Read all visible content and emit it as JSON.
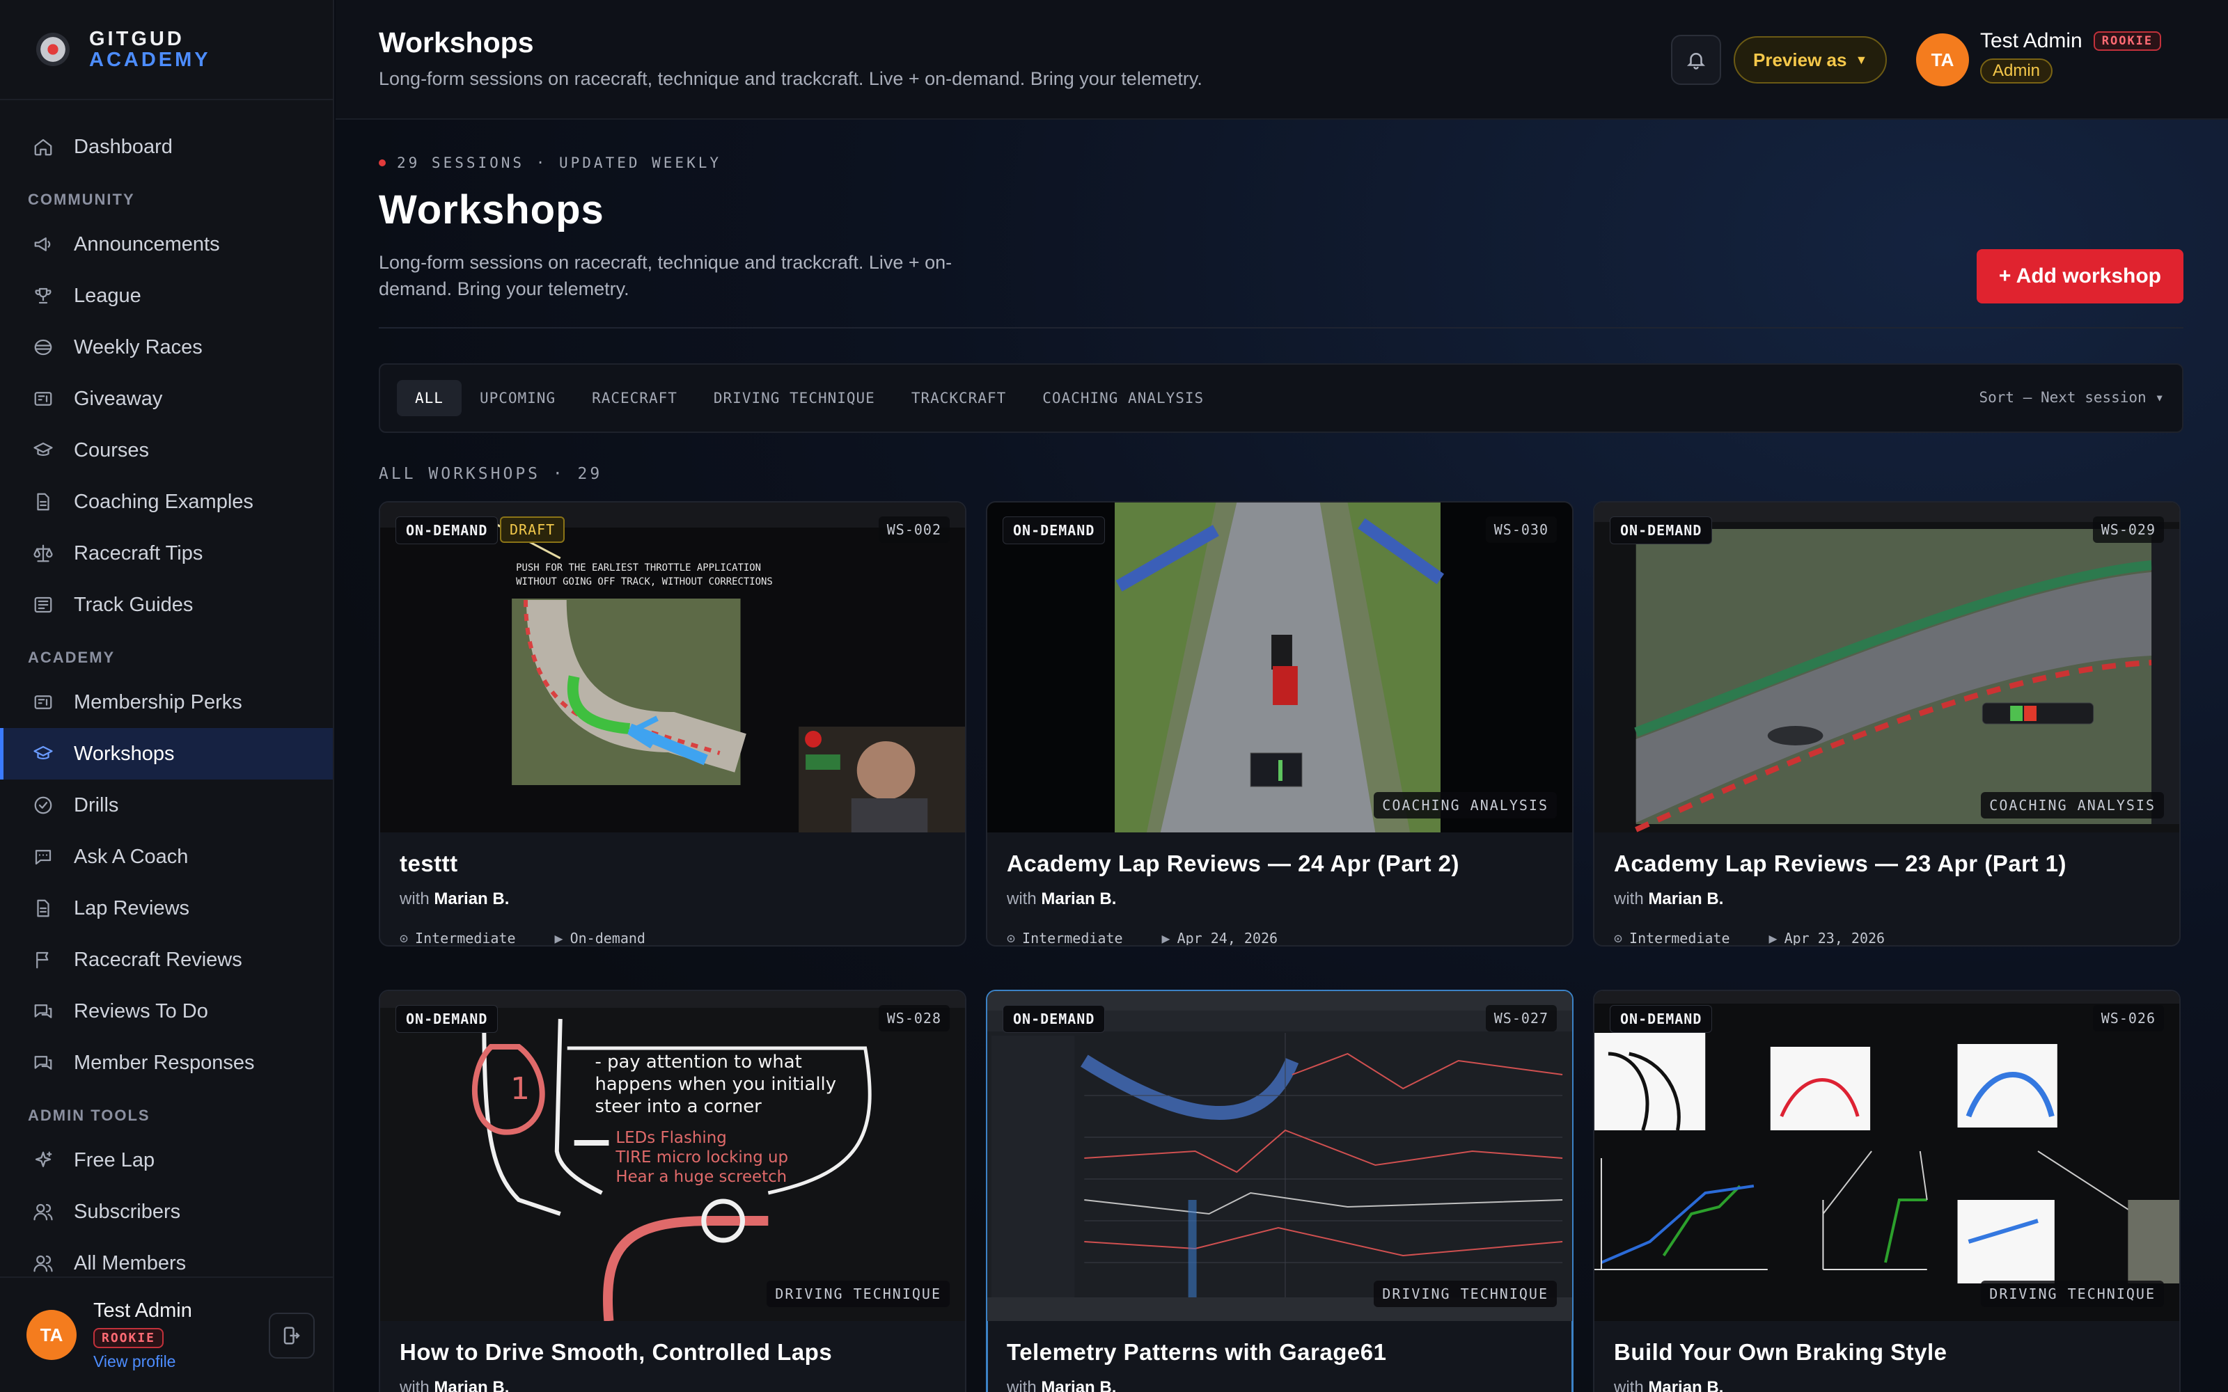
{
  "brand": {
    "line1": "GITGUD",
    "line2": "ACADEMY"
  },
  "sidebar": {
    "top_items": [
      {
        "label": "Dashboard",
        "icon": "home-icon"
      }
    ],
    "sections": [
      {
        "title": "COMMUNITY",
        "items": [
          {
            "label": "Announcements",
            "icon": "megaphone-icon"
          },
          {
            "label": "League",
            "icon": "trophy-icon"
          },
          {
            "label": "Weekly Races",
            "icon": "disc-icon"
          },
          {
            "label": "Giveaway",
            "icon": "ticket-icon"
          },
          {
            "label": "Courses",
            "icon": "graduation-cap-icon"
          },
          {
            "label": "Coaching Examples",
            "icon": "document-icon"
          },
          {
            "label": "Racecraft Tips",
            "icon": "scale-icon"
          },
          {
            "label": "Track Guides",
            "icon": "newspaper-icon"
          }
        ]
      },
      {
        "title": "ACADEMY",
        "items": [
          {
            "label": "Membership Perks",
            "icon": "ticket-icon"
          },
          {
            "label": "Workshops",
            "icon": "graduation-cap-icon",
            "active": true
          },
          {
            "label": "Drills",
            "icon": "check-circle-icon"
          },
          {
            "label": "Ask A Coach",
            "icon": "chat-icon"
          },
          {
            "label": "Lap Reviews",
            "icon": "document-icon"
          },
          {
            "label": "Racecraft Reviews",
            "icon": "flag-icon"
          },
          {
            "label": "Reviews To Do",
            "icon": "messages-icon"
          },
          {
            "label": "Member Responses",
            "icon": "messages-icon"
          }
        ]
      },
      {
        "title": "ADMIN TOOLS",
        "items": [
          {
            "label": "Free Lap",
            "icon": "sparkles-icon"
          },
          {
            "label": "Subscribers",
            "icon": "users-icon"
          },
          {
            "label": "All Members",
            "icon": "users-icon"
          }
        ]
      }
    ],
    "footer": {
      "initials": "TA",
      "name": "Test Admin",
      "rank": "ROOKIE",
      "link": "View profile"
    }
  },
  "header": {
    "title": "Workshops",
    "subtitle": "Long-form sessions on racecraft, technique and trackcraft. Live + on-demand. Bring your telemetry.",
    "preview_label": "Preview as",
    "user": {
      "initials": "TA",
      "name": "Test Admin",
      "rank": "ROOKIE",
      "role": "Admin"
    }
  },
  "page": {
    "kicker": "29 SESSIONS · UPDATED WEEKLY",
    "title": "Workshops",
    "description": "Long-form sessions on racecraft, technique and trackcraft. Live + on-demand. Bring your telemetry.",
    "add_button": "+ Add workshop",
    "filters": [
      "ALL",
      "UPCOMING",
      "RACECRAFT",
      "DRIVING TECHNIQUE",
      "TRACKCRAFT",
      "COACHING ANALYSIS"
    ],
    "active_filter": "ALL",
    "sort_label": "Sort — Next session ▾",
    "section_label": "ALL WORKSHOPS · 29"
  },
  "workshops": [
    {
      "title": "testtt",
      "host_prefix": "with",
      "host": "Marian B.",
      "level": "Intermediate",
      "when": "On-demand",
      "mode": "ON-DEMAND",
      "draft": "DRAFT",
      "code": "WS-002",
      "category": "",
      "thumb": "drawing",
      "thumb_text": "PUSH FOR THE EARLIEST THROTTLE APPLICATION WITHOUT GOING OFF TRACK, WITHOUT CORRECTIONS"
    },
    {
      "title": "Academy Lap Reviews — 24 Apr (Part 2)",
      "host_prefix": "with",
      "host": "Marian B.",
      "level": "Intermediate",
      "when": "Apr 24, 2026",
      "mode": "ON-DEMAND",
      "code": "WS-030",
      "category": "COACHING ANALYSIS",
      "thumb": "road"
    },
    {
      "title": "Academy Lap Reviews — 23 Apr (Part 1)",
      "host_prefix": "with",
      "host": "Marian B.",
      "level": "Intermediate",
      "when": "Apr 23, 2026",
      "mode": "ON-DEMAND",
      "code": "WS-029",
      "category": "COACHING ANALYSIS",
      "thumb": "track"
    },
    {
      "title": "How to Drive Smooth, Controlled Laps",
      "host_prefix": "with",
      "host": "Marian B.",
      "mode": "ON-DEMAND",
      "code": "WS-028",
      "category": "DRIVING TECHNIQUE",
      "thumb": "chalk",
      "thumb_lines": [
        "- pay attention to what",
        "happens when you initially",
        "steer into a corner",
        "LEDs Flashing",
        "TIRE micro locking up",
        "Hear a huge screetch"
      ]
    },
    {
      "title": "Telemetry Patterns with Garage61",
      "host_prefix": "with",
      "host": "Marian B.",
      "mode": "ON-DEMAND",
      "code": "WS-027",
      "category": "DRIVING TECHNIQUE",
      "thumb": "telemetry",
      "selected": true
    },
    {
      "title": "Build Your Own Braking Style",
      "host_prefix": "with",
      "host": "Marian B.",
      "mode": "ON-DEMAND",
      "code": "WS-026",
      "category": "DRIVING TECHNIQUE",
      "thumb": "whiteboard"
    }
  ],
  "colors": {
    "accent": "#3b7bff",
    "danger": "#e0232f",
    "gold": "#f5c84a",
    "avatar": "#f47c1e"
  }
}
